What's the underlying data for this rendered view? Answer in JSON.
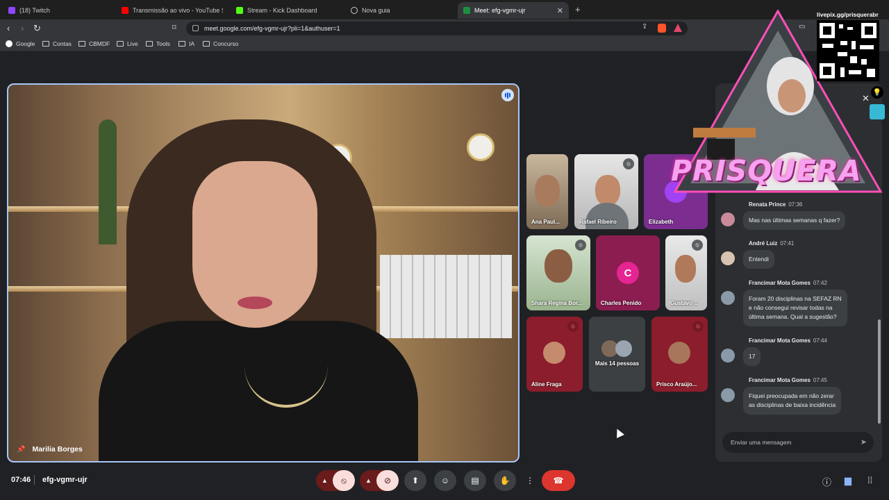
{
  "browser": {
    "tabs": [
      {
        "title": "(18) Twitch",
        "color": "#9146ff"
      },
      {
        "title": "Transmissão ao vivo - YouTube Studio",
        "color": "#ff0000"
      },
      {
        "title": "Stream - Kick Dashboard",
        "color": "#53fc18"
      },
      {
        "title": "Nova guia",
        "color": "#cccccc"
      },
      {
        "title": "Meet: efg-vgmr-ujr",
        "color": "#1e8e3e"
      }
    ],
    "new_tab_icon": "plus-icon",
    "url": "meet.google.com/efg-vgmr-ujr?pli=1&authuser=1",
    "bookmarks": [
      "Google",
      "Contas",
      "CBMDF",
      "Live",
      "Tools",
      "IA",
      "Concurso"
    ]
  },
  "main_video": {
    "name": "Marilia Borges",
    "speaking": true
  },
  "tiles": [
    {
      "name": "Ana Paul...",
      "muted": false
    },
    {
      "name": "Rafael Ribeiro",
      "muted": true
    },
    {
      "name": "Elizabeth",
      "muted": false
    },
    {
      "name": "Shara Regina Bor...",
      "muted": true
    },
    {
      "name": "Charles Penido",
      "avatar_letter": "C",
      "muted": false
    },
    {
      "name": "Gustavo ...",
      "muted": true
    },
    {
      "name": "Aline Fraga",
      "muted": true
    },
    {
      "name": "Mais 14 pessoas",
      "muted": false
    },
    {
      "name": "Prisco Araújo...",
      "muted": true
    }
  ],
  "chat": {
    "messages": [
      {
        "author": "Renata Prince",
        "time": "07:36",
        "lines": [
          "Mas nas últimas semanas q fazer?"
        ]
      },
      {
        "author": "André Luiz",
        "time": "07:41",
        "lines": [
          "Entendi"
        ]
      },
      {
        "author": "Francimar Mota Gomes",
        "time": "07:42",
        "lines": [
          "Foram 20 disciplinas na SEFAZ RN",
          "e não consegui revisar todas na",
          "última semana. Qual a sugestão?"
        ]
      },
      {
        "author": "Francimar Mota Gomes",
        "time": "07:44",
        "lines": [
          "17"
        ]
      },
      {
        "author": "Francimar Mota Gomes",
        "time": "07:45",
        "lines": [
          "Fiquei preocupada em não zerar",
          "as disciplinas de baixa incidência"
        ]
      }
    ],
    "input_placeholder": "Enviar uma mensagem"
  },
  "overlay": {
    "logo_text": "PRISQUERA",
    "qr_label": "livepix.gg/prisquerabr"
  },
  "bottom": {
    "time": "07:46",
    "meeting_code": "efg-vgmr-ujr"
  },
  "colors": {
    "accent": "#a8c7fa",
    "hangup": "#dc362e",
    "muted_tile": "#8c1d2c",
    "avatar_pink": "#e52592"
  }
}
